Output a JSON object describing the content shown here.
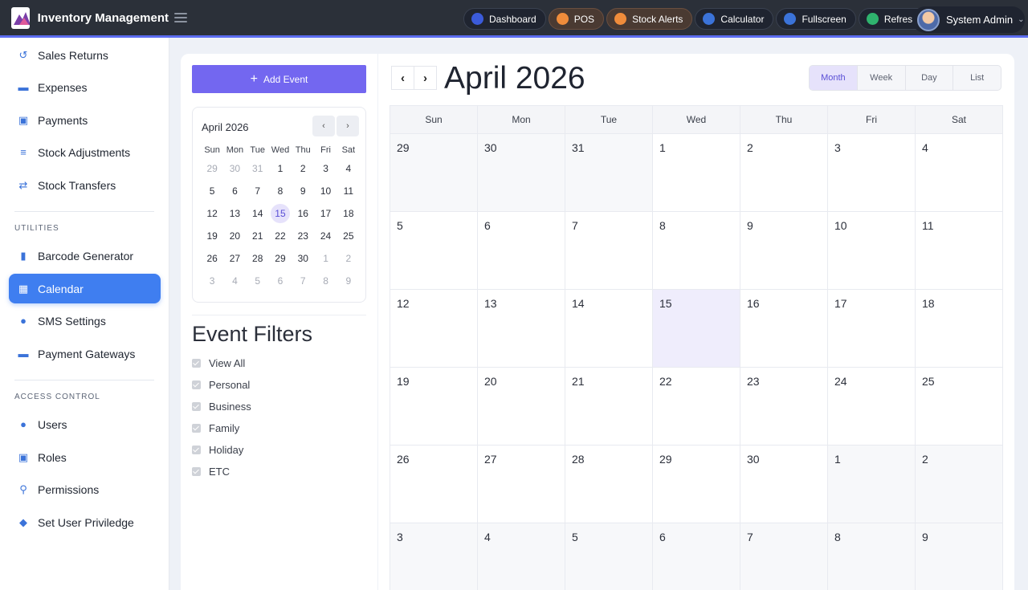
{
  "app": {
    "title": "Inventory Management"
  },
  "topbar": {
    "actions": [
      {
        "label": "Dashboard",
        "icon": "dashboard-icon",
        "color": "#3b5bdb"
      },
      {
        "label": "POS",
        "icon": "pos-icon",
        "color": "#f08c3b"
      },
      {
        "label": "Stock Alerts",
        "icon": "stock-alerts-icon",
        "color": "#f08c3b"
      },
      {
        "label": "Calculator",
        "icon": "calculator-icon",
        "color": "#3b73d9"
      },
      {
        "label": "Fullscreen",
        "icon": "fullscreen-icon",
        "color": "#3b73d9"
      },
      {
        "label": "Refresh",
        "icon": "refresh-icon",
        "color": "#2fb36e"
      }
    ],
    "user": {
      "name": "System Admin"
    }
  },
  "sidebar": {
    "items_top": [
      {
        "label": "Sales Returns",
        "icon": "return-icon"
      },
      {
        "label": "Expenses",
        "icon": "credit-card-icon"
      },
      {
        "label": "Payments",
        "icon": "payment-icon"
      },
      {
        "label": "Stock Adjustments",
        "icon": "sliders-icon"
      },
      {
        "label": "Stock Transfers",
        "icon": "shuffle-icon"
      }
    ],
    "section_utilities": "UTILITIES",
    "items_utilities": [
      {
        "label": "Barcode Generator",
        "icon": "barcode-icon"
      },
      {
        "label": "Calendar",
        "icon": "calendar-icon",
        "active": true
      },
      {
        "label": "SMS Settings",
        "icon": "chat-icon"
      },
      {
        "label": "Payment Gateways",
        "icon": "gateway-card-icon"
      }
    ],
    "section_access": "ACCESS CONTROL",
    "items_access": [
      {
        "label": "Users",
        "icon": "user-icon"
      },
      {
        "label": "Roles",
        "icon": "role-badge-icon"
      },
      {
        "label": "Permissions",
        "icon": "key-icon"
      },
      {
        "label": "Set User Priviledge",
        "icon": "shield-icon"
      }
    ]
  },
  "left_panel": {
    "add_event_label": "Add Event",
    "mini_calendar": {
      "title": "April 2026",
      "weekdays": [
        "Sun",
        "Mon",
        "Tue",
        "Wed",
        "Thu",
        "Fri",
        "Sat"
      ],
      "weeks": [
        [
          {
            "d": "29",
            "m": true
          },
          {
            "d": "30",
            "m": true
          },
          {
            "d": "31",
            "m": true
          },
          {
            "d": "1"
          },
          {
            "d": "2"
          },
          {
            "d": "3"
          },
          {
            "d": "4"
          }
        ],
        [
          {
            "d": "5"
          },
          {
            "d": "6"
          },
          {
            "d": "7"
          },
          {
            "d": "8"
          },
          {
            "d": "9"
          },
          {
            "d": "10"
          },
          {
            "d": "11"
          }
        ],
        [
          {
            "d": "12"
          },
          {
            "d": "13"
          },
          {
            "d": "14"
          },
          {
            "d": "15",
            "t": true
          },
          {
            "d": "16"
          },
          {
            "d": "17"
          },
          {
            "d": "18"
          }
        ],
        [
          {
            "d": "19"
          },
          {
            "d": "20"
          },
          {
            "d": "21"
          },
          {
            "d": "22"
          },
          {
            "d": "23"
          },
          {
            "d": "24"
          },
          {
            "d": "25"
          }
        ],
        [
          {
            "d": "26"
          },
          {
            "d": "27"
          },
          {
            "d": "28"
          },
          {
            "d": "29"
          },
          {
            "d": "30"
          },
          {
            "d": "1",
            "m": true
          },
          {
            "d": "2",
            "m": true
          }
        ],
        [
          {
            "d": "3",
            "m": true
          },
          {
            "d": "4",
            "m": true
          },
          {
            "d": "5",
            "m": true
          },
          {
            "d": "6",
            "m": true
          },
          {
            "d": "7",
            "m": true
          },
          {
            "d": "8",
            "m": true
          },
          {
            "d": "9",
            "m": true
          }
        ]
      ]
    },
    "filters_title": "Event Filters",
    "filters": [
      "View All",
      "Personal",
      "Business",
      "Family",
      "Holiday",
      "ETC"
    ]
  },
  "calendar": {
    "title": "April 2026",
    "views": [
      {
        "label": "Month",
        "active": true
      },
      {
        "label": "Week"
      },
      {
        "label": "Day"
      },
      {
        "label": "List"
      }
    ],
    "weekdays": [
      "Sun",
      "Mon",
      "Tue",
      "Wed",
      "Thu",
      "Fri",
      "Sat"
    ],
    "weeks": [
      [
        {
          "d": "29",
          "m": true
        },
        {
          "d": "30",
          "m": true
        },
        {
          "d": "31",
          "m": true
        },
        {
          "d": "1"
        },
        {
          "d": "2"
        },
        {
          "d": "3"
        },
        {
          "d": "4"
        }
      ],
      [
        {
          "d": "5"
        },
        {
          "d": "6"
        },
        {
          "d": "7"
        },
        {
          "d": "8"
        },
        {
          "d": "9"
        },
        {
          "d": "10"
        },
        {
          "d": "11"
        }
      ],
      [
        {
          "d": "12"
        },
        {
          "d": "13"
        },
        {
          "d": "14"
        },
        {
          "d": "15",
          "t": true
        },
        {
          "d": "16"
        },
        {
          "d": "17"
        },
        {
          "d": "18"
        }
      ],
      [
        {
          "d": "19"
        },
        {
          "d": "20"
        },
        {
          "d": "21"
        },
        {
          "d": "22"
        },
        {
          "d": "23"
        },
        {
          "d": "24"
        },
        {
          "d": "25"
        }
      ],
      [
        {
          "d": "26"
        },
        {
          "d": "27"
        },
        {
          "d": "28"
        },
        {
          "d": "29"
        },
        {
          "d": "30"
        },
        {
          "d": "1",
          "m": true
        },
        {
          "d": "2",
          "m": true
        }
      ],
      [
        {
          "d": "3",
          "m": true
        },
        {
          "d": "4",
          "m": true
        },
        {
          "d": "5",
          "m": true
        },
        {
          "d": "6",
          "m": true
        },
        {
          "d": "7",
          "m": true
        },
        {
          "d": "8",
          "m": true
        },
        {
          "d": "9",
          "m": true
        }
      ]
    ]
  }
}
